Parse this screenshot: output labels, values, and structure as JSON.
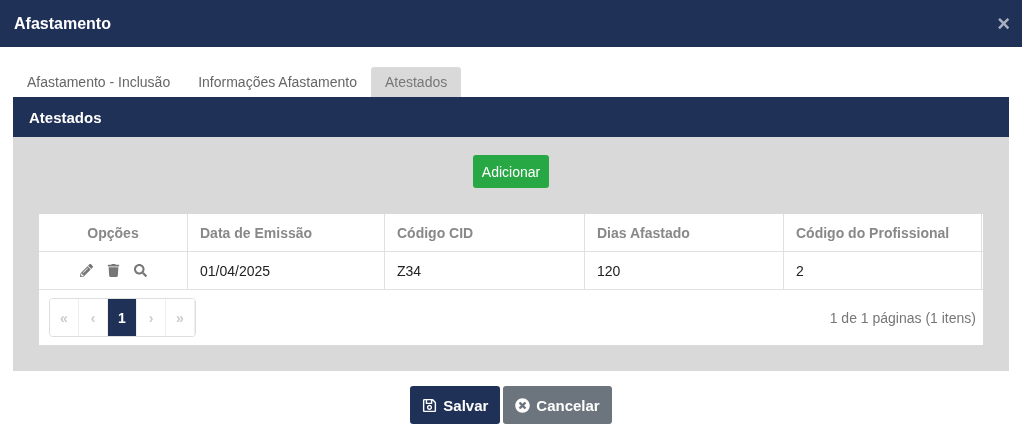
{
  "window": {
    "title": "Afastamento",
    "close": "×"
  },
  "tabs": [
    {
      "label": "Afastamento - Inclusão",
      "selected": false
    },
    {
      "label": "Informações Afastamento",
      "selected": false
    },
    {
      "label": "Atestados",
      "selected": true
    }
  ],
  "panel": {
    "title": "Atestados",
    "add_button": "Adicionar"
  },
  "table": {
    "columns": [
      "Opções",
      "Data de Emissão",
      "Código CID",
      "Dias Afastado",
      "Código do Profissional"
    ],
    "rows": [
      {
        "cells": [
          "",
          "01/04/2025",
          "Z34",
          "120",
          "2"
        ]
      }
    ]
  },
  "pager": {
    "buttons": [
      {
        "label": "«",
        "selected": false,
        "disabled": true
      },
      {
        "label": "‹",
        "selected": false,
        "disabled": true
      },
      {
        "label": "1",
        "selected": true,
        "disabled": false
      },
      {
        "label": "›",
        "selected": false,
        "disabled": true
      },
      {
        "label": "»",
        "selected": false,
        "disabled": true
      }
    ],
    "summary": "1 de 1 páginas (1 itens)"
  },
  "footer": {
    "save": "Salvar",
    "cancel": "Cancelar"
  }
}
